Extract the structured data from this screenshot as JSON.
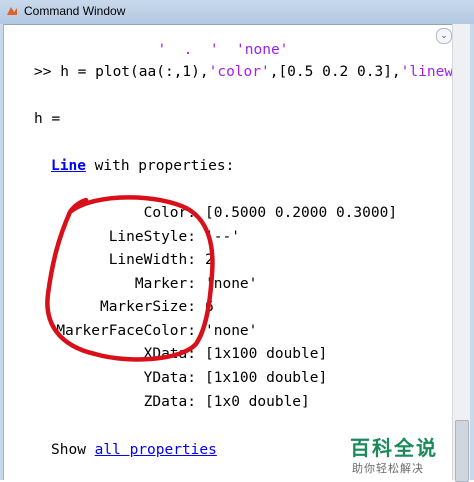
{
  "window": {
    "title": "Command Window"
  },
  "command": {
    "prompt": ">>",
    "code_prefix": " h = plot(aa(:,1),",
    "str1": "'color'",
    "code_mid": ",[0.5 0.2 0.3],",
    "str2": "'linewidth"
  },
  "partial_top": "  '  .  '  'none'",
  "output": {
    "var": "h =",
    "class_link": "Line",
    "class_suffix": " with properties:",
    "properties": [
      {
        "name": "Color:",
        "value": "[0.5000 0.2000 0.3000]"
      },
      {
        "name": "LineStyle:",
        "value": "'--'"
      },
      {
        "name": "LineWidth:",
        "value": "2"
      },
      {
        "name": "Marker:",
        "value": "'none'"
      },
      {
        "name": "MarkerSize:",
        "value": "6"
      },
      {
        "name": "MarkerFaceColor:",
        "value": "'none'"
      },
      {
        "name": "XData:",
        "value": "[1x100 double]"
      },
      {
        "name": "YData:",
        "value": "[1x100 double]"
      },
      {
        "name": "ZData:",
        "value": "[1x0 double]"
      }
    ],
    "show_prefix": "Show ",
    "show_link": "all properties"
  },
  "watermark": {
    "title": "百科全说",
    "subtitle": "助你轻松解决"
  },
  "annotation_color": "#d8101a"
}
